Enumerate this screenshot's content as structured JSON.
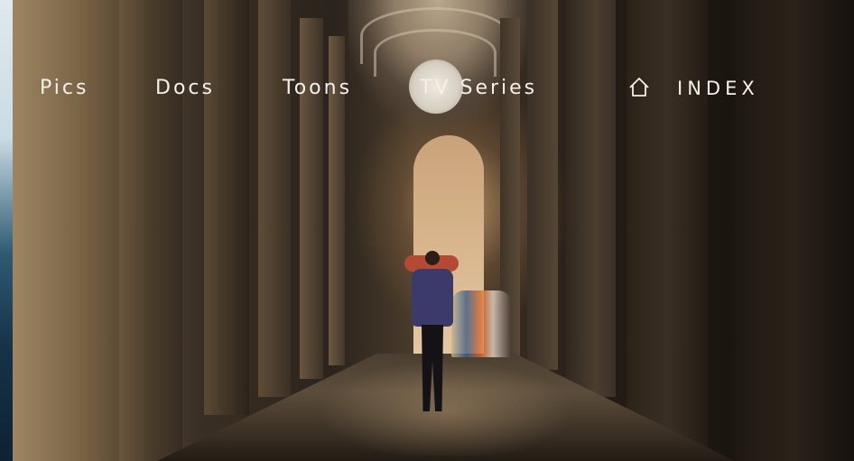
{
  "nav": {
    "items": [
      {
        "label": "Pics"
      },
      {
        "label": "Docs"
      },
      {
        "label": "Toons"
      },
      {
        "label": "TV Series"
      }
    ],
    "index": {
      "label": "INDEX",
      "icon": "home-icon"
    }
  },
  "colors": {
    "nav_text": "#f4f0ea",
    "background": "#1a140e"
  }
}
